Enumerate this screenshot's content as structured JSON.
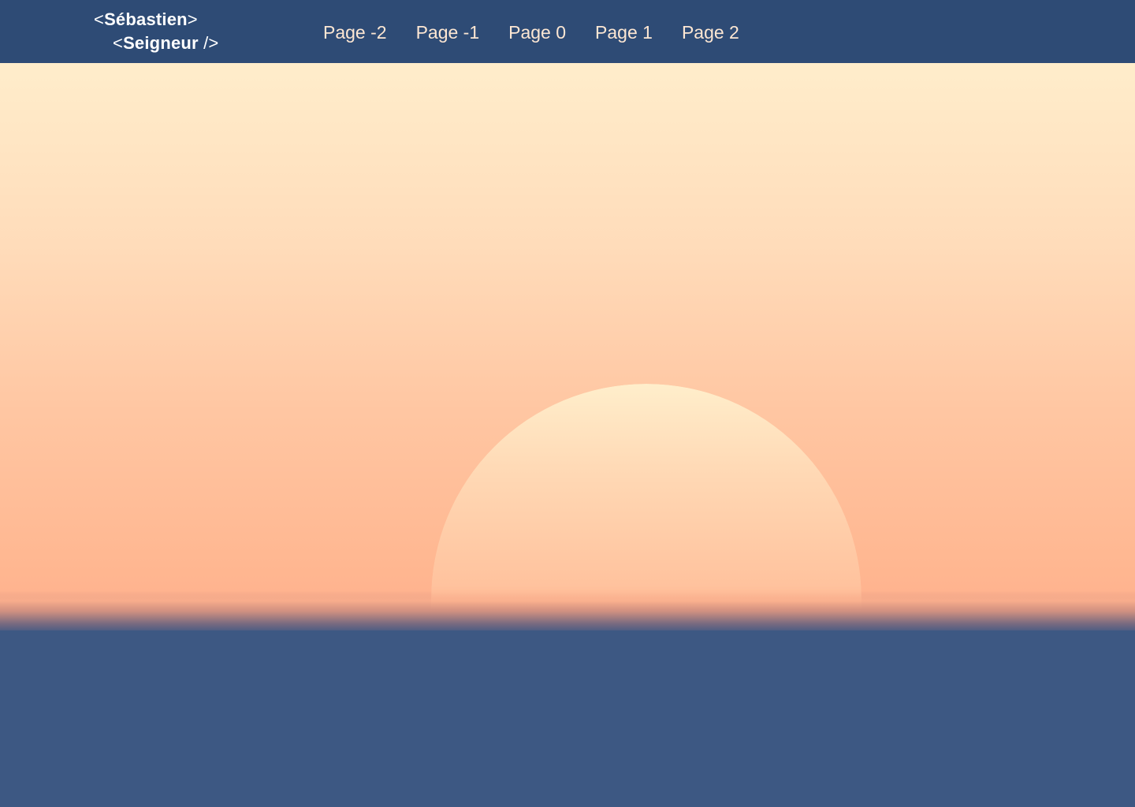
{
  "logo": {
    "line1_open": "<",
    "line1_name": "Sébastien",
    "line1_close": ">",
    "line2_open": "<",
    "line2_name": "Seigneur",
    "line2_close": " />"
  },
  "nav": {
    "links": [
      {
        "label": "Page -2"
      },
      {
        "label": "Page -1"
      },
      {
        "label": "Page 0"
      },
      {
        "label": "Page 1"
      },
      {
        "label": "Page 2"
      }
    ]
  },
  "colors": {
    "navbar_background": "#2e4b75",
    "nav_text": "#fde7d3",
    "sky_top": "#ffedcb",
    "sky_bottom": "#ffb38f",
    "sun_top": "#ffeecb",
    "sea": "#3d5883"
  }
}
